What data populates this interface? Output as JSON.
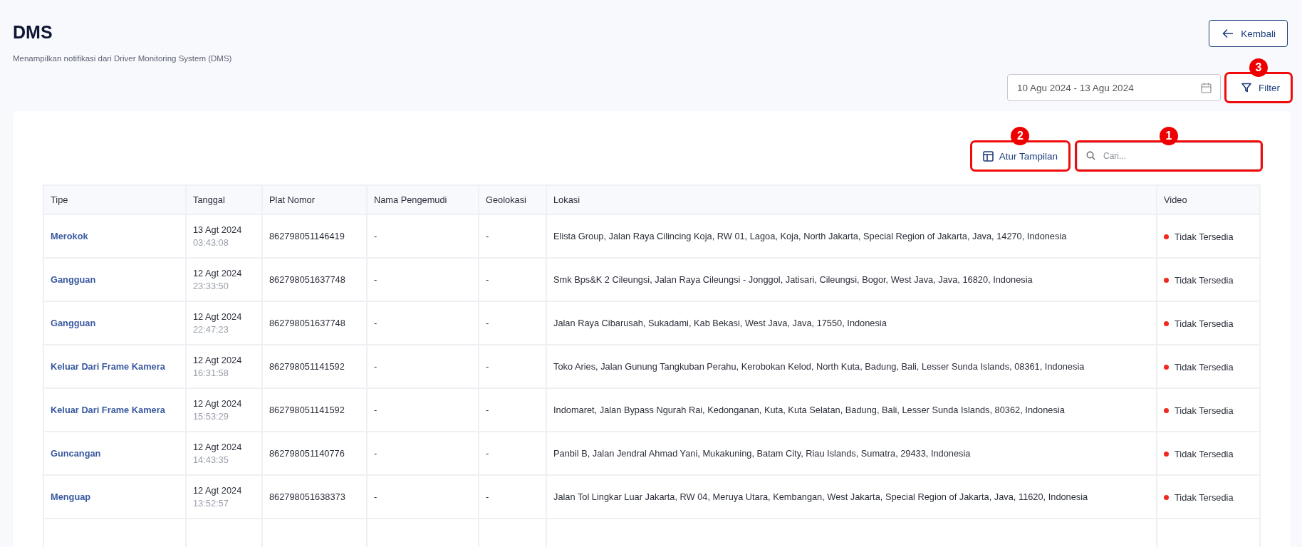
{
  "header": {
    "title": "DMS",
    "subtitle": "Menampilkan notifikasi dari Driver Monitoring System (DMS)",
    "back_button": "Kembali"
  },
  "toolbar": {
    "date_range": "10 Agu 2024 - 13 Agu 2024",
    "filter_button": {
      "label": "Filter",
      "callout": "3"
    }
  },
  "table_tools": {
    "view_button": {
      "label": "Atur Tampilan",
      "callout": "2"
    },
    "search": {
      "placeholder": "Cari...",
      "callout": "1"
    }
  },
  "table": {
    "columns": [
      "Tipe",
      "Tanggal",
      "Plat Nomor",
      "Nama Pengemudi",
      "Geolokasi",
      "Lokasi",
      "Video"
    ],
    "rows": [
      {
        "tipe": "Merokok",
        "date": "13 Agt 2024",
        "time": "03:43:08",
        "plat": "862798051146419",
        "driver": "-",
        "geo": "-",
        "lokasi": "Elista Group, Jalan Raya Cilincing Koja, RW 01, Lagoa, Koja, North Jakarta, Special Region of Jakarta, Java, 14270, Indonesia",
        "video": {
          "status": "Tidak Tersedia",
          "color": "#f0281e"
        }
      },
      {
        "tipe": "Gangguan",
        "date": "12 Agt 2024",
        "time": "23:33:50",
        "plat": "862798051637748",
        "driver": "-",
        "geo": "-",
        "lokasi": "Smk Bps&K 2 Cileungsi, Jalan Raya Cileungsi - Jonggol, Jatisari, Cileungsi, Bogor, West Java, Java, 16820, Indonesia",
        "video": {
          "status": "Tidak Tersedia",
          "color": "#f0281e"
        }
      },
      {
        "tipe": "Gangguan",
        "date": "12 Agt 2024",
        "time": "22:47:23",
        "plat": "862798051637748",
        "driver": "-",
        "geo": "-",
        "lokasi": "Jalan Raya Cibarusah, Sukadami, Kab Bekasi, West Java, Java, 17550, Indonesia",
        "video": {
          "status": "Tidak Tersedia",
          "color": "#f0281e"
        }
      },
      {
        "tipe": "Keluar Dari Frame Kamera",
        "date": "12 Agt 2024",
        "time": "16:31:58",
        "plat": "862798051141592",
        "driver": "-",
        "geo": "-",
        "lokasi": "Toko Aries, Jalan Gunung Tangkuban Perahu, Kerobokan Kelod, North Kuta, Badung, Bali, Lesser Sunda Islands, 08361, Indonesia",
        "video": {
          "status": "Tidak Tersedia",
          "color": "#f0281e"
        }
      },
      {
        "tipe": "Keluar Dari Frame Kamera",
        "date": "12 Agt 2024",
        "time": "15:53:29",
        "plat": "862798051141592",
        "driver": "-",
        "geo": "-",
        "lokasi": "Indomaret, Jalan Bypass Ngurah Rai, Kedonganan, Kuta, Kuta Selatan, Badung, Bali, Lesser Sunda Islands, 80362, Indonesia",
        "video": {
          "status": "Tidak Tersedia",
          "color": "#f0281e"
        }
      },
      {
        "tipe": "Guncangan",
        "date": "12 Agt 2024",
        "time": "14:43:35",
        "plat": "862798051140776",
        "driver": "-",
        "geo": "-",
        "lokasi": "Panbil B, Jalan Jendral Ahmad Yani, Mukakuning, Batam City, Riau Islands, Sumatra, 29433, Indonesia",
        "video": {
          "status": "Tidak Tersedia",
          "color": "#f0281e"
        }
      },
      {
        "tipe": "Menguap",
        "date": "12 Agt 2024",
        "time": "13:52:57",
        "plat": "862798051638373",
        "driver": "-",
        "geo": "-",
        "lokasi": "Jalan Tol Lingkar Luar Jakarta, RW 04, Meruya Utara, Kembangan, West Jakarta, Special Region of Jakarta, Java, 11620, Indonesia",
        "video": {
          "status": "Tidak Tersedia",
          "color": "#f0281e"
        }
      }
    ]
  }
}
